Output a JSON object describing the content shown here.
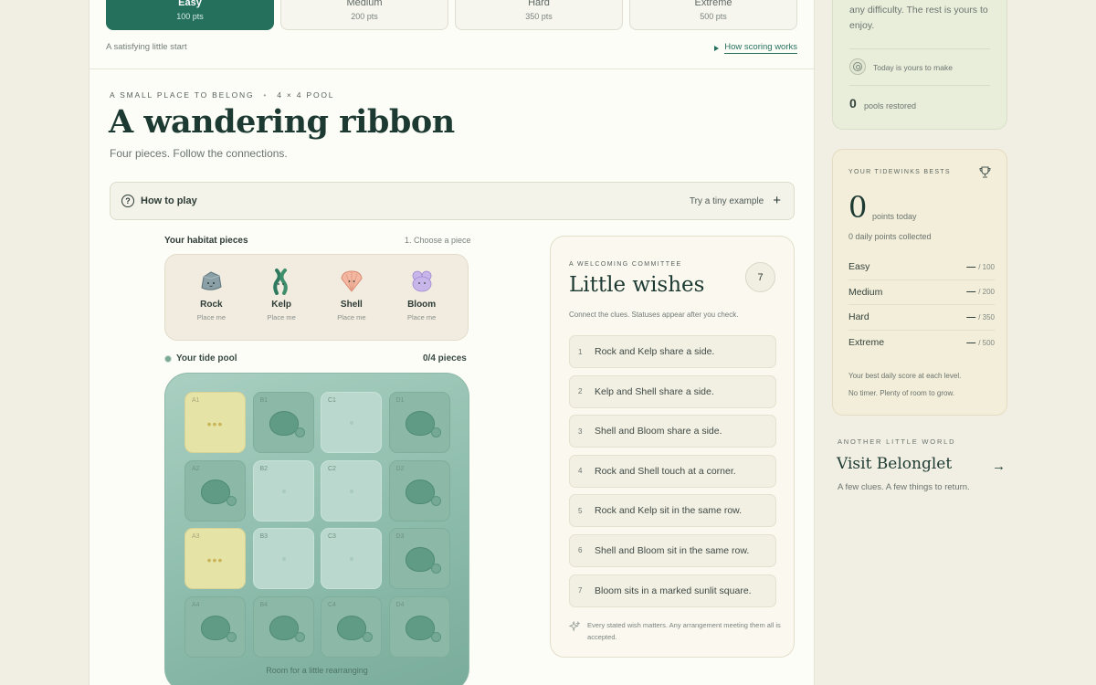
{
  "difficulty": {
    "tabs": [
      {
        "name": "Easy",
        "pts": "100 pts"
      },
      {
        "name": "Medium",
        "pts": "200 pts"
      },
      {
        "name": "Hard",
        "pts": "350 pts"
      },
      {
        "name": "Extreme",
        "pts": "500 pts"
      }
    ],
    "selected": "Easy",
    "subtitle": "A satisfying little start",
    "scoring_link": "How scoring works"
  },
  "puzzle": {
    "eyebrow": "A SMALL PLACE TO BELONG",
    "size": "4 × 4 POOL",
    "title": "A wandering ribbon",
    "subtitle": "Four pieces. Follow the connections."
  },
  "how_to_play": {
    "label": "How to play",
    "example": "Try a tiny example"
  },
  "pieces": {
    "header": "Your habitat pieces",
    "step": "1. Choose a piece",
    "items": [
      {
        "name": "Rock",
        "hint": "Place me",
        "icon": "rock-icon"
      },
      {
        "name": "Kelp",
        "hint": "Place me",
        "icon": "kelp-icon"
      },
      {
        "name": "Shell",
        "hint": "Place me",
        "icon": "shell-icon"
      },
      {
        "name": "Bloom",
        "hint": "Place me",
        "icon": "bloom-icon"
      }
    ]
  },
  "pool": {
    "header": "Your tide pool",
    "count": "0/4 pieces",
    "footer": "Room for a little rearranging",
    "cells": [
      {
        "id": "A1",
        "type": "sunlit"
      },
      {
        "id": "B1",
        "type": "rock"
      },
      {
        "id": "C1",
        "type": "empty"
      },
      {
        "id": "D1",
        "type": "rock"
      },
      {
        "id": "A2",
        "type": "rock"
      },
      {
        "id": "B2",
        "type": "empty"
      },
      {
        "id": "C2",
        "type": "empty"
      },
      {
        "id": "D2",
        "type": "rock"
      },
      {
        "id": "A3",
        "type": "sunlit"
      },
      {
        "id": "B3",
        "type": "empty"
      },
      {
        "id": "C3",
        "type": "empty"
      },
      {
        "id": "D3",
        "type": "rock"
      },
      {
        "id": "A4",
        "type": "rock"
      },
      {
        "id": "B4",
        "type": "rock"
      },
      {
        "id": "C4",
        "type": "rock"
      },
      {
        "id": "D4",
        "type": "rock"
      }
    ]
  },
  "wishes": {
    "eyebrow": "A WELCOMING COMMITTEE",
    "title": "Little wishes",
    "count": "7",
    "description": "Connect the clues. Statuses appear after you check.",
    "clues": [
      {
        "n": "1",
        "text": "Rock and Kelp share a side."
      },
      {
        "n": "2",
        "text": "Kelp and Shell share a side."
      },
      {
        "n": "3",
        "text": "Shell and Bloom share a side."
      },
      {
        "n": "4",
        "text": "Rock and Shell touch at a corner."
      },
      {
        "n": "5",
        "text": "Rock and Kelp sit in the same row."
      },
      {
        "n": "6",
        "text": "Shell and Bloom sit in the same row."
      },
      {
        "n": "7",
        "text": "Bloom sits in a marked sunlit square."
      }
    ],
    "footer": "Every stated wish matters. Any arrangement meeting them all is accepted."
  },
  "sidebar": {
    "intro": "any difficulty. The rest is yours to enjoy.",
    "today": "Today is yours to make",
    "pools_count": "0",
    "pools_label": "pools restored",
    "bests": {
      "eyebrow": "YOUR TIDEWINKS BESTS",
      "points": "0",
      "points_label": "points today",
      "daily": "0 daily points collected",
      "levels": [
        {
          "name": "Easy",
          "value": "—",
          "max": "/ 100"
        },
        {
          "name": "Medium",
          "value": "—",
          "max": "/ 200"
        },
        {
          "name": "Hard",
          "value": "—",
          "max": "/ 350"
        },
        {
          "name": "Extreme",
          "value": "—",
          "max": "/ 500"
        }
      ],
      "note1": "Your best daily score at each level.",
      "note2": "No timer. Plenty of room to grow."
    },
    "other_world": {
      "eyebrow": "ANOTHER LITTLE WORLD",
      "title": "Visit Belonglet",
      "subtitle": "A few clues. A few things to return."
    }
  },
  "colors": {
    "accent": "#24705d",
    "pool": "#8dbcac",
    "sunlit": "#e6e3a6",
    "background": "#f1efe3"
  }
}
